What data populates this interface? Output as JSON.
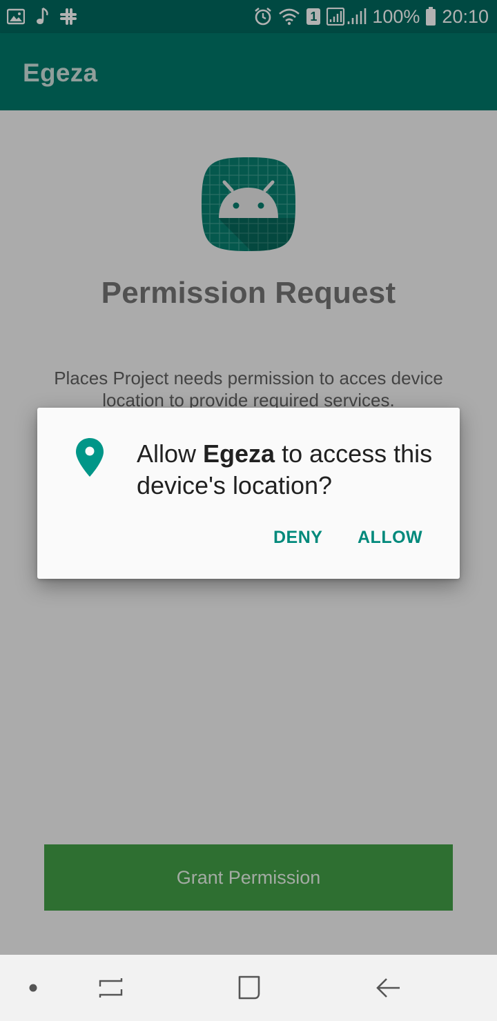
{
  "status_bar": {
    "battery": "100%",
    "time": "20:10",
    "sim_slot": "1",
    "left_icons": [
      "gallery-icon",
      "music-note-icon",
      "slack-icon"
    ],
    "right_icons": [
      "alarm-icon",
      "wifi-icon",
      "sim-icon",
      "signal-icon",
      "battery-icon"
    ]
  },
  "app_bar": {
    "title": "Egeza"
  },
  "main": {
    "title": "Permission Request",
    "description": "Places Project needs permission to acces device location to provide required services.",
    "grant_button": "Grant Permission"
  },
  "dialog": {
    "message_prefix": "Allow ",
    "app_name": "Egeza",
    "message_suffix": " to access this device's location?",
    "deny": "DENY",
    "allow": "ALLOW",
    "icon": "location-pin-icon"
  },
  "nav_bar": {
    "items": [
      "dot-icon",
      "recents-icon",
      "home-icon",
      "back-icon"
    ]
  },
  "colors": {
    "status_bar": "#00695f",
    "app_bar": "#00796b",
    "accent": "#00897b",
    "grant_button": "#43a047"
  }
}
